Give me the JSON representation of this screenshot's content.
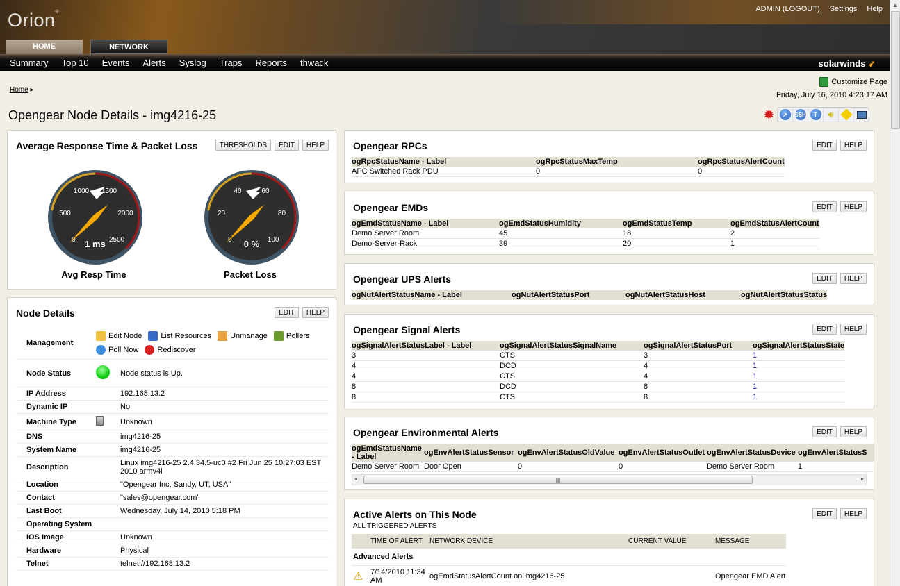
{
  "header": {
    "app_name": "Orion",
    "trademark": "®",
    "user_link": "ADMIN (LOGOUT)",
    "settings": "Settings",
    "help": "Help",
    "brand": "solarwinds"
  },
  "tabs": [
    {
      "label": "HOME",
      "active": true
    },
    {
      "label": "NETWORK",
      "active": false
    }
  ],
  "nav": [
    "Summary",
    "Top 10",
    "Events",
    "Alerts",
    "Syslog",
    "Traps",
    "Reports",
    "thwack"
  ],
  "breadcrumb": {
    "home": "Home"
  },
  "page": {
    "title": "Opengear Node Details - img4216-25",
    "customize": "Customize Page",
    "datetime": "Friday, July 16, 2010 4:23:17 AM"
  },
  "toolbar_icons": [
    "settings-gear-icon",
    "remote-desktop-icon",
    "ssh-icon",
    "telnet-icon",
    "sound-alert-icon",
    "traceroute-icon",
    "web-browse-icon"
  ],
  "toolbar_ssh": "SSH",
  "toolbar_t": "T",
  "buttons": {
    "thresholds": "THRESHOLDS",
    "edit": "EDIT",
    "help": "HELP"
  },
  "gauges": {
    "title": "Average Response Time & Packet Loss",
    "items": [
      {
        "label": "Avg Resp Time",
        "value_text": "1 ms",
        "value": 1,
        "max": 2500,
        "ticks": [
          "0",
          "500",
          "1000",
          "1500",
          "2000",
          "2500"
        ]
      },
      {
        "label": "Packet Loss",
        "value_text": "0 %",
        "value": 0,
        "max": 100,
        "ticks": [
          "0",
          "20",
          "40",
          "60",
          "80",
          "100"
        ]
      }
    ],
    "colors": {
      "warning": "#d4a020",
      "critical": "#a01818",
      "needle": "#f5a800"
    }
  },
  "node_details": {
    "title": "Node Details",
    "management_label": "Management",
    "management": [
      "Edit Node",
      "List Resources",
      "Unmanage",
      "Pollers",
      "Poll Now",
      "Rediscover"
    ],
    "rows": [
      {
        "k": "Node Status",
        "v": "Node status is Up.",
        "icon": "status-up-icon"
      },
      {
        "k": "IP Address",
        "v": "192.168.13.2"
      },
      {
        "k": "Dynamic IP",
        "v": "No"
      },
      {
        "k": "Machine Type",
        "v": "Unknown",
        "icon": "machine-icon"
      },
      {
        "k": "DNS",
        "v": "img4216-25"
      },
      {
        "k": "System Name",
        "v": "img4216-25"
      },
      {
        "k": "Description",
        "v": "Linux img4216-25 2.4.34.5-uc0 #2 Fri Jun 25 10:27:03 EST 2010 armv4l"
      },
      {
        "k": "Location",
        "v": "\"Opengear Inc, Sandy, UT, USA\""
      },
      {
        "k": "Contact",
        "v": "\"sales@opengear.com\""
      },
      {
        "k": "Last Boot",
        "v": "Wednesday, July 14, 2010 5:18 PM"
      },
      {
        "k": "Operating System",
        "v": ""
      },
      {
        "k": "IOS Image",
        "v": "Unknown"
      },
      {
        "k": "Hardware",
        "v": "Physical"
      },
      {
        "k": "Telnet",
        "v": "telnet://192.168.13.2"
      }
    ]
  },
  "rpcs": {
    "title": "Opengear RPCs",
    "columns": [
      "ogRpcStatusName - Label",
      "ogRpcStatusMaxTemp",
      "ogRpcStatusAlertCount"
    ],
    "rows": [
      [
        "APC Switched Rack PDU",
        "0",
        "0"
      ]
    ]
  },
  "emds": {
    "title": "Opengear EMDs",
    "columns": [
      "ogEmdStatusName - Label",
      "ogEmdStatusHumidity",
      "ogEmdStatusTemp",
      "ogEmdStatusAlertCount"
    ],
    "rows": [
      [
        "Demo Server Room",
        "45",
        "18",
        "2"
      ],
      [
        "Demo-Server-Rack",
        "39",
        "20",
        "1"
      ]
    ]
  },
  "ups": {
    "title": "Opengear UPS Alerts",
    "columns": [
      "ogNutAlertStatusName - Label",
      "ogNutAlertStatusPort",
      "ogNutAlertStatusHost",
      "ogNutAlertStatusStatus"
    ],
    "rows": []
  },
  "signal": {
    "title": "Opengear Signal Alerts",
    "columns": [
      "ogSignalAlertStatusLabel - Label",
      "ogSignalAlertStatusSignalName",
      "ogSignalAlertStatusPort",
      "ogSignalAlertStatusState"
    ],
    "rows": [
      [
        "3",
        "CTS",
        "3",
        "1"
      ],
      [
        "4",
        "DCD",
        "4",
        "1"
      ],
      [
        "4",
        "CTS",
        "4",
        "1"
      ],
      [
        "8",
        "DCD",
        "8",
        "1"
      ],
      [
        "8",
        "CTS",
        "8",
        "1"
      ]
    ]
  },
  "env": {
    "title": "Opengear Environmental Alerts",
    "columns": [
      "ogEmdStatusName - Label",
      "ogEnvAlertStatusSensor",
      "ogEnvAlertStatusOldValue",
      "ogEnvAlertStatusOutlet",
      "ogEnvAlertStatusDevice",
      "ogEnvAlertStatusS"
    ],
    "rows": [
      [
        "Demo Server Room",
        "Door Open",
        "0",
        "0",
        "Demo Server Room",
        "1"
      ]
    ]
  },
  "active_alerts": {
    "title": "Active Alerts on This Node",
    "subtitle": "ALL TRIGGERED ALERTS",
    "columns": [
      "",
      "TIME OF ALERT",
      "NETWORK DEVICE",
      "CURRENT VALUE",
      "MESSAGE"
    ],
    "group": "Advanced Alerts",
    "rows": [
      {
        "time": "7/14/2010 11:34 AM",
        "device": "ogEmdStatusAlertCount on img4216-25",
        "value": "",
        "message": "Opengear EMD Alert"
      }
    ]
  }
}
